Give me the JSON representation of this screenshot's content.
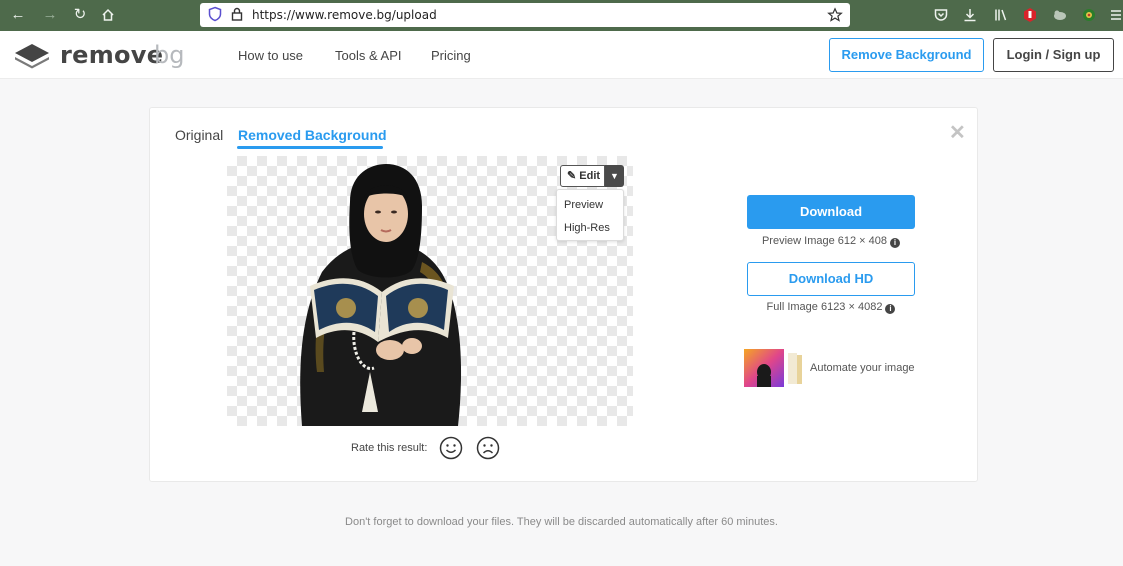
{
  "browser": {
    "url": "https://www.remove.bg/upload",
    "icons": [
      "back-icon",
      "forward-icon",
      "reload-icon",
      "home-icon",
      "shield-icon",
      "lock-icon",
      "star-icon",
      "pocket-icon",
      "download-icon",
      "library-icon",
      "extension-icon",
      "menu-icon"
    ]
  },
  "header": {
    "logo_part1": "remove",
    "logo_part2": "bg",
    "nav": [
      "How to use",
      "Tools & API",
      "Pricing"
    ],
    "remove_bg_button": "Remove Background",
    "login_button": "Login / Sign up"
  },
  "card": {
    "tab_original": "Original",
    "tab_removed": "Removed Background",
    "edit_label": "Edit",
    "dropdown_items": [
      "Preview",
      "High-Res"
    ],
    "rate_label": "Rate this result:",
    "download_label": "Download",
    "preview_info": "Preview Image 612 × 408",
    "download_hd_label": "Download HD",
    "full_info": "Full Image 6123 × 4082",
    "automate_label": "Automate your image"
  },
  "footer": {
    "note": "Don't forget to download your files. They will be discarded automatically after 60 minutes."
  },
  "colors": {
    "accent": "#2a9bef",
    "browser_chrome": "#4e6a4b",
    "text_dark": "#454545"
  }
}
